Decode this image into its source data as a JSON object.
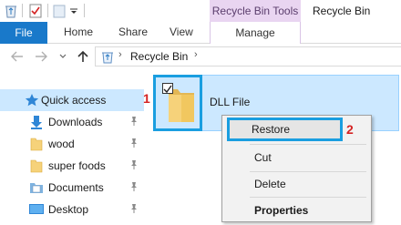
{
  "window": {
    "title": "Recycle Bin",
    "context_tab_group": "Recycle Bin Tools"
  },
  "ribbon": {
    "tabs": [
      {
        "label": "File"
      },
      {
        "label": "Home"
      },
      {
        "label": "Share"
      },
      {
        "label": "View"
      },
      {
        "label": "Manage"
      }
    ]
  },
  "address": {
    "path": "Recycle Bin"
  },
  "nav_pane": {
    "items": [
      {
        "label": "Quick access",
        "icon": "star-icon"
      },
      {
        "label": "Downloads",
        "icon": "download-arrow-icon"
      },
      {
        "label": "wood",
        "icon": "folder-icon"
      },
      {
        "label": "super foods",
        "icon": "folder-icon"
      },
      {
        "label": "Documents",
        "icon": "documents-icon"
      },
      {
        "label": "Desktop",
        "icon": "desktop-icon"
      }
    ]
  },
  "file": {
    "name": "DLL File",
    "checked": true
  },
  "context_menu": {
    "items": [
      {
        "label": "Restore"
      },
      {
        "label": "Cut"
      },
      {
        "label": "Delete"
      },
      {
        "label": "Properties"
      }
    ]
  },
  "steps": {
    "step1": "1",
    "step2": "2"
  },
  "colors": {
    "file_tab": "#1979ca",
    "context_tab": "#e9d5f1",
    "selection": "#cce8ff",
    "highlight_box": "#1a9ee0",
    "step_number": "#d42323"
  }
}
